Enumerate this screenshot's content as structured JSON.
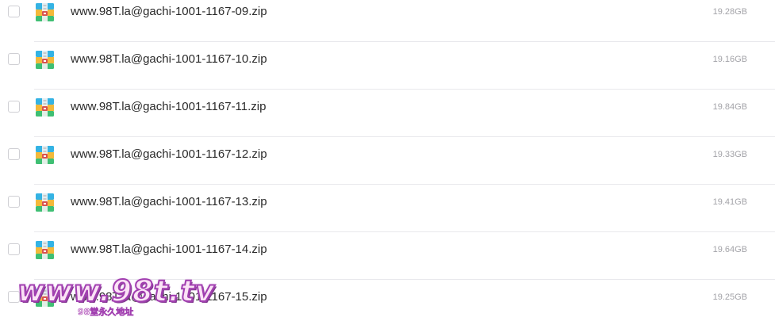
{
  "files": [
    {
      "name": "www.98T.la@gachi-1001-1167-09.zip",
      "size": "19.28GB",
      "icon": "zip-archive-icon"
    },
    {
      "name": "www.98T.la@gachi-1001-1167-10.zip",
      "size": "19.16GB",
      "icon": "zip-archive-icon"
    },
    {
      "name": "www.98T.la@gachi-1001-1167-11.zip",
      "size": "19.84GB",
      "icon": "zip-archive-icon"
    },
    {
      "name": "www.98T.la@gachi-1001-1167-12.zip",
      "size": "19.33GB",
      "icon": "zip-archive-icon"
    },
    {
      "name": "www.98T.la@gachi-1001-1167-13.zip",
      "size": "19.41GB",
      "icon": "zip-archive-icon"
    },
    {
      "name": "www.98T.la@gachi-1001-1167-14.zip",
      "size": "19.64GB",
      "icon": "zip-archive-icon"
    },
    {
      "name": "www.98T.la@gachi-1001-1167-15.zip",
      "size": "19.25GB",
      "icon": "zip-archive-icon"
    }
  ],
  "watermark": {
    "main": "www.98t.tv",
    "sub": "98堂永久地址"
  },
  "colors": {
    "text": "#2a2a2a",
    "size_text": "#a3a3a8",
    "divider": "#e8e8ec",
    "checkbox_border": "#cfcfd4",
    "watermark_fill": "#fbe3f6",
    "watermark_stroke": "#a13fb0"
  }
}
